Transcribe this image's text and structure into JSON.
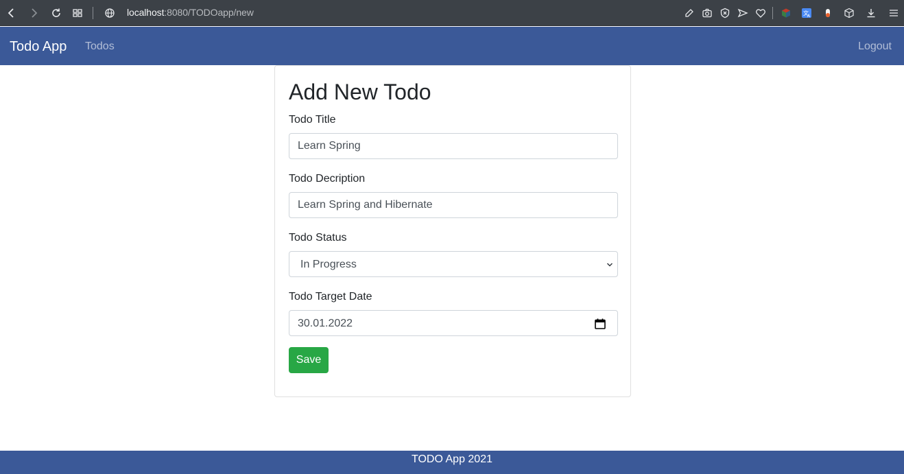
{
  "browser": {
    "url_host": "localhost",
    "url_rest": ":8080/TODOapp/new"
  },
  "navbar": {
    "brand": "Todo App",
    "todos_link": "Todos",
    "logout_link": "Logout"
  },
  "form": {
    "heading": "Add New Todo",
    "title_label": "Todo Title",
    "title_value": "Learn Spring",
    "description_label": "Todo Decription",
    "description_value": "Learn Spring and Hibernate",
    "status_label": "Todo Status",
    "status_value": "In Progress",
    "date_label": "Todo Target Date",
    "date_value": "30.01.2022",
    "save_label": "Save"
  },
  "footer": {
    "text": "TODO App 2021"
  },
  "colors": {
    "navbar_bg": "#3b5998",
    "save_button": "#28a745",
    "browser_chrome": "#3c4147"
  }
}
